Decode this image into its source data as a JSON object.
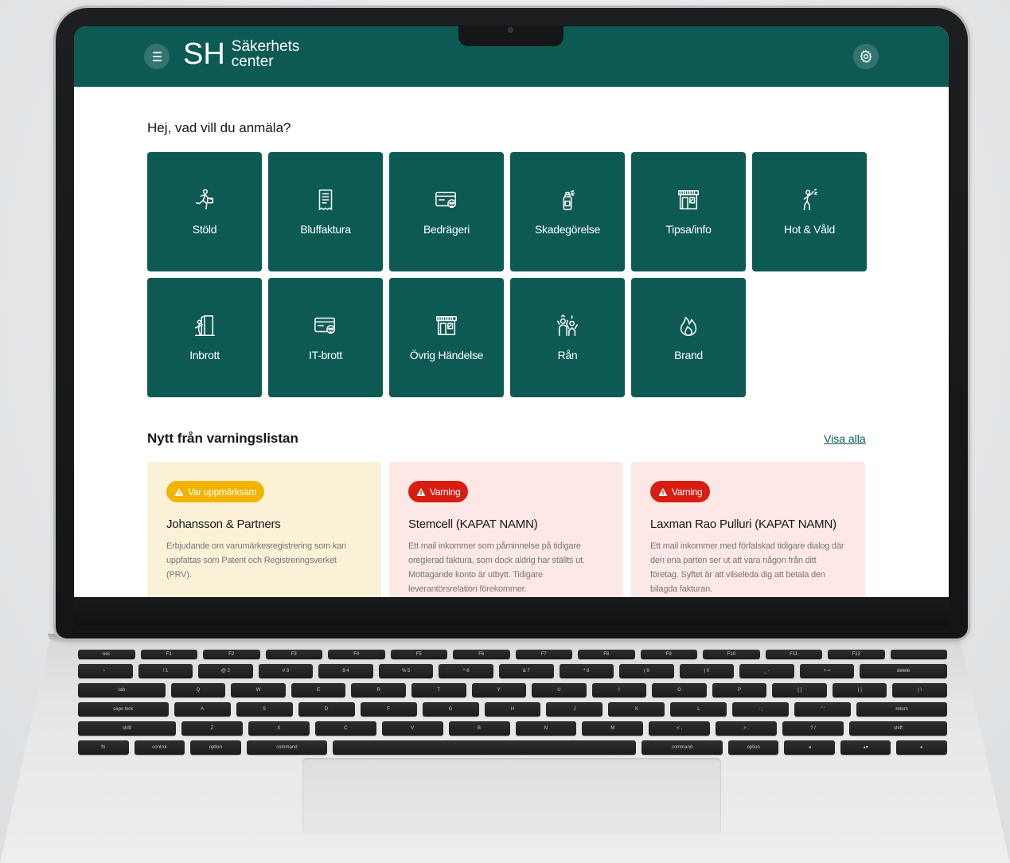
{
  "brand": {
    "logo_mark": "SH",
    "name_line1": "Säkerhets",
    "name_line2": "center"
  },
  "heading": "Hej, vad vill du anmäla?",
  "tiles": [
    {
      "icon": "running-thief-icon",
      "label": "Stöld"
    },
    {
      "icon": "receipt-icon",
      "label": "Bluffaktura"
    },
    {
      "icon": "card-skull-icon",
      "label": "Bedrägeri"
    },
    {
      "icon": "spray-can-icon",
      "label": "Skadegörelse"
    },
    {
      "icon": "storefront-icon",
      "label": "Tipsa/info"
    },
    {
      "icon": "threat-person-icon",
      "label": "Hot & Våld"
    },
    {
      "icon": "door-intruder-icon",
      "label": "Inbrott"
    },
    {
      "icon": "card-skull-icon",
      "label": "IT-brott"
    },
    {
      "icon": "storefront-icon",
      "label": "Övrig Händelse"
    },
    {
      "icon": "robbery-icon",
      "label": "Rån"
    },
    {
      "icon": "fire-icon",
      "label": "Brand"
    }
  ],
  "warnings": {
    "title": "Nytt från varningslistan",
    "view_all": "Visa alla",
    "cards": [
      {
        "badge": "Var uppmärksam",
        "title": "Johansson & Partners",
        "text": "Erbjudande om varumärkesregistrering som kan uppfattas som Patent och Registreringsverket (PRV)."
      },
      {
        "badge": "Varning",
        "title": "Stemcell (KAPAT NAMN)",
        "text": "Ett mail inkommer som påminnelse på tidigare oreglerad faktura, som dock aldrig har ställts ut. Mottagande konto är utbytt. Tidigare leverantörsrelation förekommer."
      },
      {
        "badge": "Varning",
        "title": "Laxman Rao Pulluri (KAPAT NAMN)",
        "text": "Ett mail inkommer med förfalskad tidigare dialog där den ena parten ser ut att vara någon från ditt företag. Syftet är att vilseleda dig att betala den bilagda fakturan."
      }
    ]
  },
  "keyboard": {
    "fn_row": [
      "esc",
      "F1",
      "F2",
      "F3",
      "F4",
      "F5",
      "F6",
      "F7",
      "F8",
      "F9",
      "F10",
      "F11",
      "F12",
      ""
    ],
    "num_row": [
      "~ `",
      "! 1",
      "@ 2",
      "# 3",
      "$ 4",
      "% 5",
      "^ 6",
      "& 7",
      "* 8",
      "( 9",
      ") 0",
      "_ -",
      "+ =",
      "delete"
    ],
    "q_row": [
      "tab",
      "Q",
      "W",
      "E",
      "R",
      "T",
      "Y",
      "U",
      "I",
      "O",
      "P",
      "{ [",
      "} ]",
      "| \\"
    ],
    "a_row": [
      "caps lock",
      "A",
      "S",
      "D",
      "F",
      "G",
      "H",
      "J",
      "K",
      "L",
      ": ;",
      "\" '",
      "return"
    ],
    "z_row": [
      "shift",
      "Z",
      "X",
      "C",
      "V",
      "B",
      "N",
      "M",
      "< ,",
      "> .",
      "? /",
      "shift"
    ],
    "bottom_row": [
      "fn",
      "control",
      "option",
      "command",
      "",
      "command",
      "option",
      "◂",
      "▴▾",
      "▸"
    ]
  },
  "colors": {
    "brand_teal": "#0d5a55",
    "caution_bg": "#fbf1d6",
    "caution_badge": "#f2b400",
    "danger_bg": "#fde8e6",
    "danger_badge": "#d81e12"
  }
}
